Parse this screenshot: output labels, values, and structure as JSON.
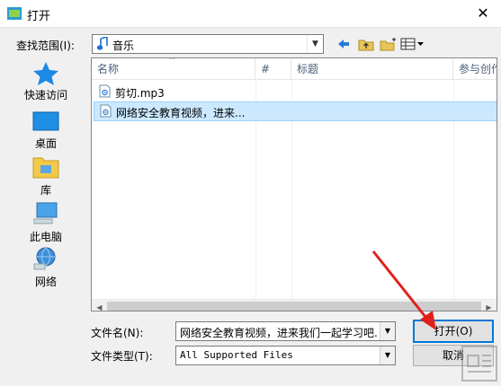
{
  "window": {
    "title": "打开",
    "close_glyph": "✕"
  },
  "lookin": {
    "label": "查找范围(I):",
    "value": "音乐"
  },
  "places": [
    {
      "label": "快速访问",
      "icon": "star-icon"
    },
    {
      "label": "桌面",
      "icon": "desktop-icon"
    },
    {
      "label": "库",
      "icon": "library-icon"
    },
    {
      "label": "此电脑",
      "icon": "computer-icon"
    },
    {
      "label": "网络",
      "icon": "network-icon"
    }
  ],
  "columns": [
    "名称",
    "#",
    "标题",
    "参与创作"
  ],
  "files": [
    {
      "name": "剪切.mp3",
      "selected": false
    },
    {
      "name": "网络安全教育视频，进来...",
      "selected": true
    }
  ],
  "filename": {
    "label": "文件名(N):",
    "value": "网络安全教育视频，进来我们一起学习吧..."
  },
  "filetype": {
    "label": "文件类型(T):",
    "value": "All Supported Files"
  },
  "buttons": {
    "open": "打开(O)",
    "cancel": "取消"
  },
  "colors": {
    "accent": "#0078d7",
    "selection": "#cce8ff",
    "arrow": "#e0201c"
  }
}
